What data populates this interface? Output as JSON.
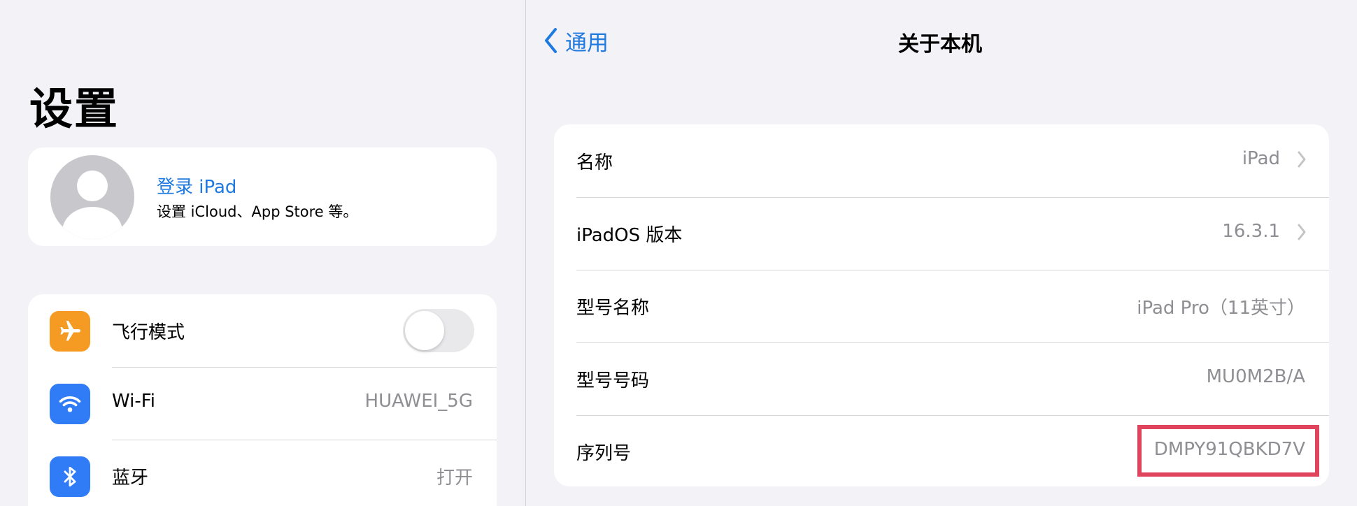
{
  "sidebar": {
    "title": "设置",
    "profile": {
      "title": "登录 iPad",
      "subtitle": "设置 iCloud、App Store 等。"
    },
    "items": [
      {
        "label": "飞行模式",
        "icon": "airplane-icon",
        "icon_color": "#f59a23",
        "toggle_on": false
      },
      {
        "label": "Wi-Fi",
        "value": "HUAWEI_5G",
        "icon": "wifi-icon",
        "icon_color": "#2f7cf6"
      },
      {
        "label": "蓝牙",
        "value": "打开",
        "icon": "bluetooth-icon",
        "icon_color": "#2f7cf6"
      }
    ]
  },
  "nav": {
    "back_label": "通用",
    "title": "关于本机"
  },
  "about": {
    "rows": [
      {
        "label": "名称",
        "value": "iPad",
        "chevron": true
      },
      {
        "label": "iPadOS 版本",
        "value": "16.3.1",
        "chevron": true
      },
      {
        "label": "型号名称",
        "value": "iPad Pro（11英寸）",
        "chevron": false
      },
      {
        "label": "型号号码",
        "value": "MU0M2B/A",
        "chevron": false
      },
      {
        "label": "序列号",
        "value": "DMPY91QBKD7V",
        "chevron": false
      }
    ]
  },
  "colors": {
    "accent": "#1f7ae0",
    "highlight": "#e0435c",
    "secondary_text": "#8e8e93"
  }
}
